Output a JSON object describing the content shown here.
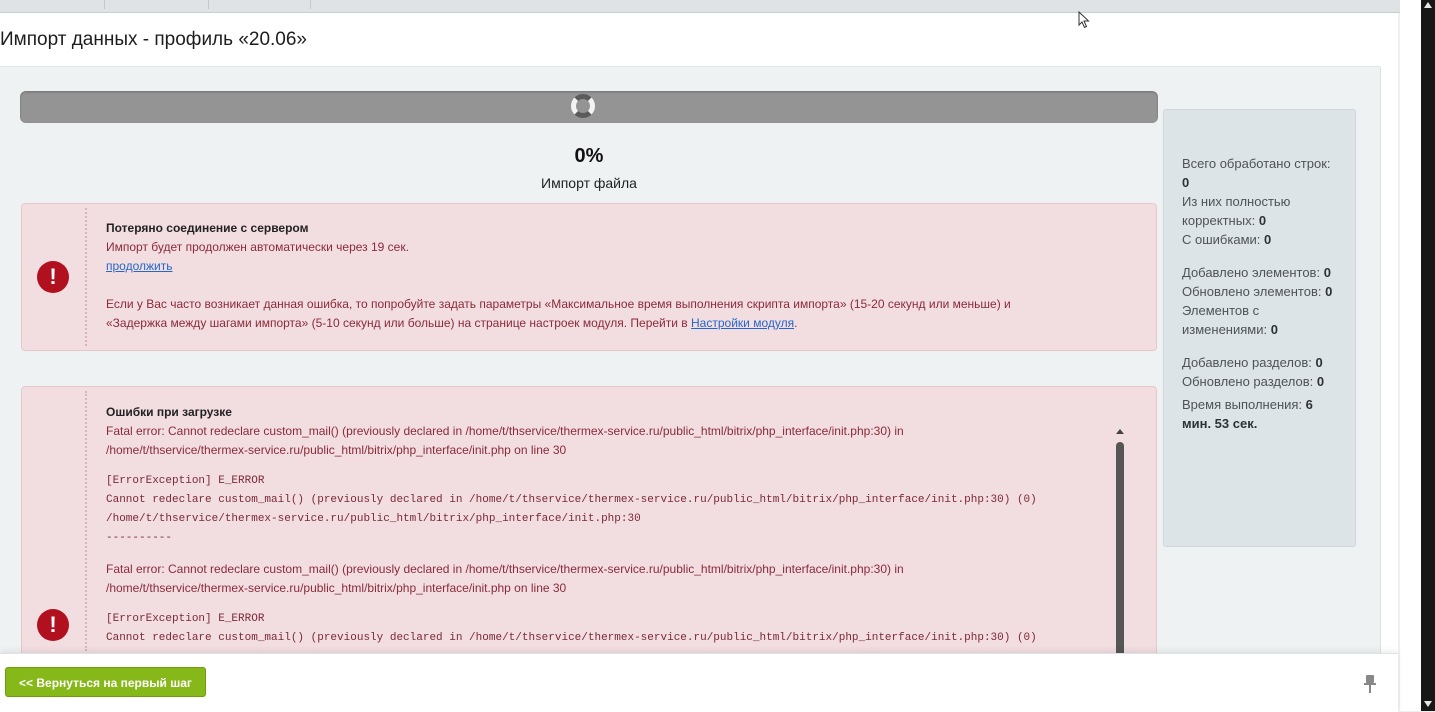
{
  "page": {
    "title": "Импорт данных - профиль «20.06»"
  },
  "progress": {
    "fraction": 0,
    "percent_label": "0%",
    "stage_label": "Импорт файла"
  },
  "connection_alert": {
    "heading": "Потеряно соединение с сервером",
    "line1": "Импорт будет продолжен автоматически через 19 сек.",
    "continue_link": "продолжить",
    "advice_line1": "Если у Вас часто возникает данная ошибка, то попробуйте задать параметры «Максимальное время выполнения скрипта импорта» (15-20 секунд или меньше) и",
    "advice_line2": "«Задержка между шагами импорта» (5-10 секунд или больше) на странице настроек модуля. Перейти в",
    "settings_link": "Настройки модуля",
    "advice_end": "."
  },
  "errors_alert": {
    "heading": "Ошибки при загрузке",
    "fatal_line1": "Fatal error: Cannot redeclare custom_mail() (previously declared in /home/t/thservice/thermex-service.ru/public_html/bitrix/php_interface/init.php:30) in",
    "fatal_line2": "/home/t/thservice/thermex-service.ru/public_html/bitrix/php_interface/init.php on line 30",
    "exc_tag": "[ErrorException] E_ERROR",
    "exc_line1": "Cannot redeclare custom_mail() (previously declared in /home/t/thservice/thermex-service.ru/public_html/bitrix/php_interface/init.php:30) (0)",
    "exc_line2": "/home/t/thservice/thermex-service.ru/public_html/bitrix/php_interface/init.php:30",
    "separator": "----------",
    "fatal2_line1": "Fatal error: Cannot redeclare custom_mail() (previously declared in /home/t/thservice/thermex-service.ru/public_html/bitrix/php_interface/init.php:30) in",
    "fatal2_line2": "/home/t/thservice/thermex-service.ru/public_html/bitrix/php_interface/init.php on line 30",
    "exc2_tag": "[ErrorException] E_ERROR",
    "exc2_line1": "Cannot redeclare custom_mail() (previously declared in /home/t/thservice/thermex-service.ru/public_html/bitrix/php_interface/init.php:30) (0)"
  },
  "stats": {
    "total_label": "Всего обработано строк:",
    "total_value": "0",
    "correct_label": "Из них полностью корректных:",
    "correct_value": "0",
    "errors_label": "С ошибками:",
    "errors_value": "0",
    "added_label": "Добавлено элементов:",
    "added_value": "0",
    "updated_label": "Обновлено элементов:",
    "updated_value": "0",
    "changed_label": "Элементов с изменениями:",
    "changed_value": "0",
    "sections_added_label": "Добавлено разделов:",
    "sections_added_value": "0",
    "sections_updated_label": "Обновлено разделов:",
    "sections_updated_value": "0",
    "time_label": "Время выполнения:",
    "time_value": "6 мин. 53 сек."
  },
  "footer": {
    "back_button": "<< Вернуться на первый шаг"
  },
  "icons": {
    "error": "exclamation-circle-icon",
    "pin": "pin-icon",
    "spinner": "loading-spinner-icon"
  },
  "colors": {
    "alert_bg": "#f2dde1",
    "alert_text": "#8a2b3a",
    "error_icon": "#b1101e",
    "button_green": "#86b81a",
    "progress_bar": "#949494",
    "link": "#2467c8"
  }
}
